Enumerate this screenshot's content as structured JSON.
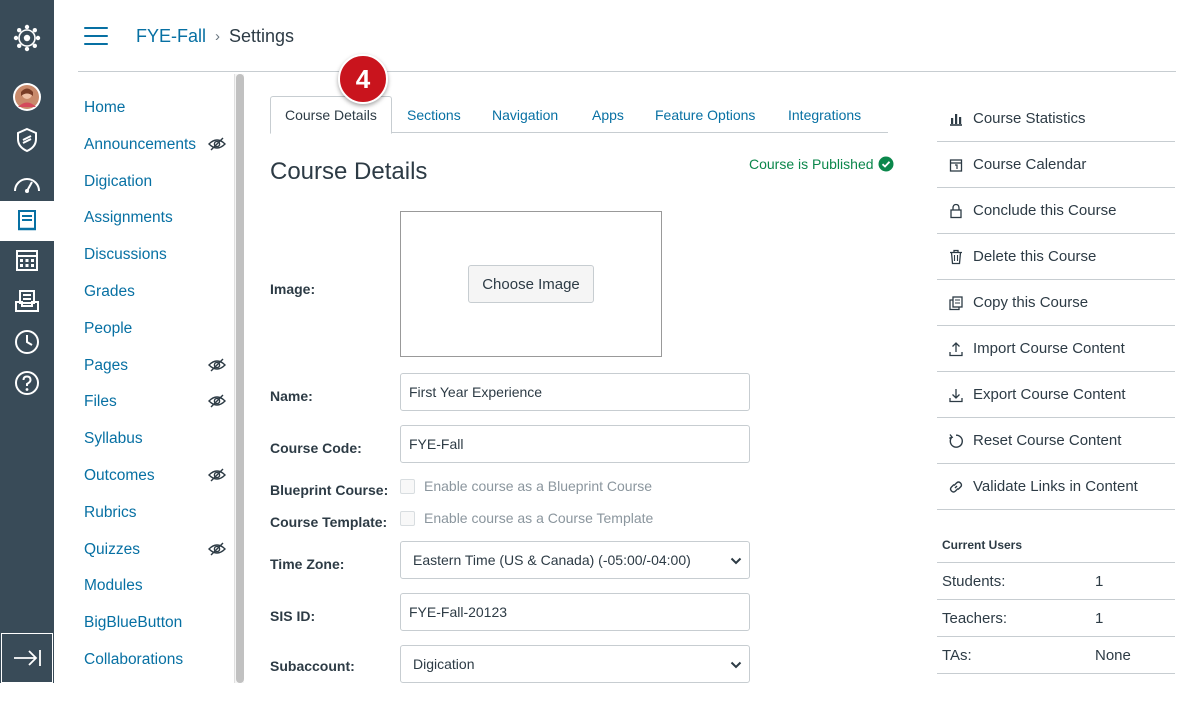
{
  "breadcrumb": {
    "course": "FYE-Fall",
    "page": "Settings"
  },
  "course_nav": [
    {
      "label": "Home",
      "hidden": false
    },
    {
      "label": "Announcements",
      "hidden": true
    },
    {
      "label": "Digication",
      "hidden": false
    },
    {
      "label": "Assignments",
      "hidden": false
    },
    {
      "label": "Discussions",
      "hidden": false
    },
    {
      "label": "Grades",
      "hidden": false
    },
    {
      "label": "People",
      "hidden": false
    },
    {
      "label": "Pages",
      "hidden": true
    },
    {
      "label": "Files",
      "hidden": true
    },
    {
      "label": "Syllabus",
      "hidden": false
    },
    {
      "label": "Outcomes",
      "hidden": true
    },
    {
      "label": "Rubrics",
      "hidden": false
    },
    {
      "label": "Quizzes",
      "hidden": true
    },
    {
      "label": "Modules",
      "hidden": false
    },
    {
      "label": "BigBlueButton",
      "hidden": false
    },
    {
      "label": "Collaborations",
      "hidden": false
    }
  ],
  "tabs": [
    "Course Details",
    "Sections",
    "Navigation",
    "Apps",
    "Feature Options",
    "Integrations"
  ],
  "step_badge": "4",
  "page_title": "Course Details",
  "published_status": "Course is Published",
  "form": {
    "image_label": "Image:",
    "choose_image": "Choose Image",
    "name_label": "Name:",
    "name_value": "First Year Experience",
    "code_label": "Course Code:",
    "code_value": "FYE-Fall",
    "blueprint_label": "Blueprint Course:",
    "blueprint_text": "Enable course as a Blueprint Course",
    "template_label": "Course Template:",
    "template_text": "Enable course as a Course Template",
    "timezone_label": "Time Zone:",
    "timezone_value": "Eastern Time (US & Canada) (-05:00/-04:00)",
    "sis_label": "SIS ID:",
    "sis_value": "FYE-Fall-20123",
    "subaccount_label": "Subaccount:",
    "subaccount_value": "Digication"
  },
  "sidebar_actions": [
    {
      "label": "Course Statistics",
      "icon": "bar-chart-icon"
    },
    {
      "label": "Course Calendar",
      "icon": "calendar-icon"
    },
    {
      "label": "Conclude this Course",
      "icon": "lock-icon"
    },
    {
      "label": "Delete this Course",
      "icon": "trash-icon"
    },
    {
      "label": "Copy this Course",
      "icon": "copy-icon"
    },
    {
      "label": "Import Course Content",
      "icon": "upload-icon"
    },
    {
      "label": "Export Course Content",
      "icon": "download-icon"
    },
    {
      "label": "Reset Course Content",
      "icon": "reset-icon"
    },
    {
      "label": "Validate Links in Content",
      "icon": "link-icon"
    }
  ],
  "current_users": {
    "title": "Current Users",
    "rows": [
      {
        "label": "Students:",
        "value": "1"
      },
      {
        "label": "Teachers:",
        "value": "1"
      },
      {
        "label": "TAs:",
        "value": "None"
      }
    ]
  },
  "colors": {
    "nav_bg": "#394b58",
    "link": "#0770a3",
    "published": "#0b874b",
    "badge": "#c9141d"
  }
}
